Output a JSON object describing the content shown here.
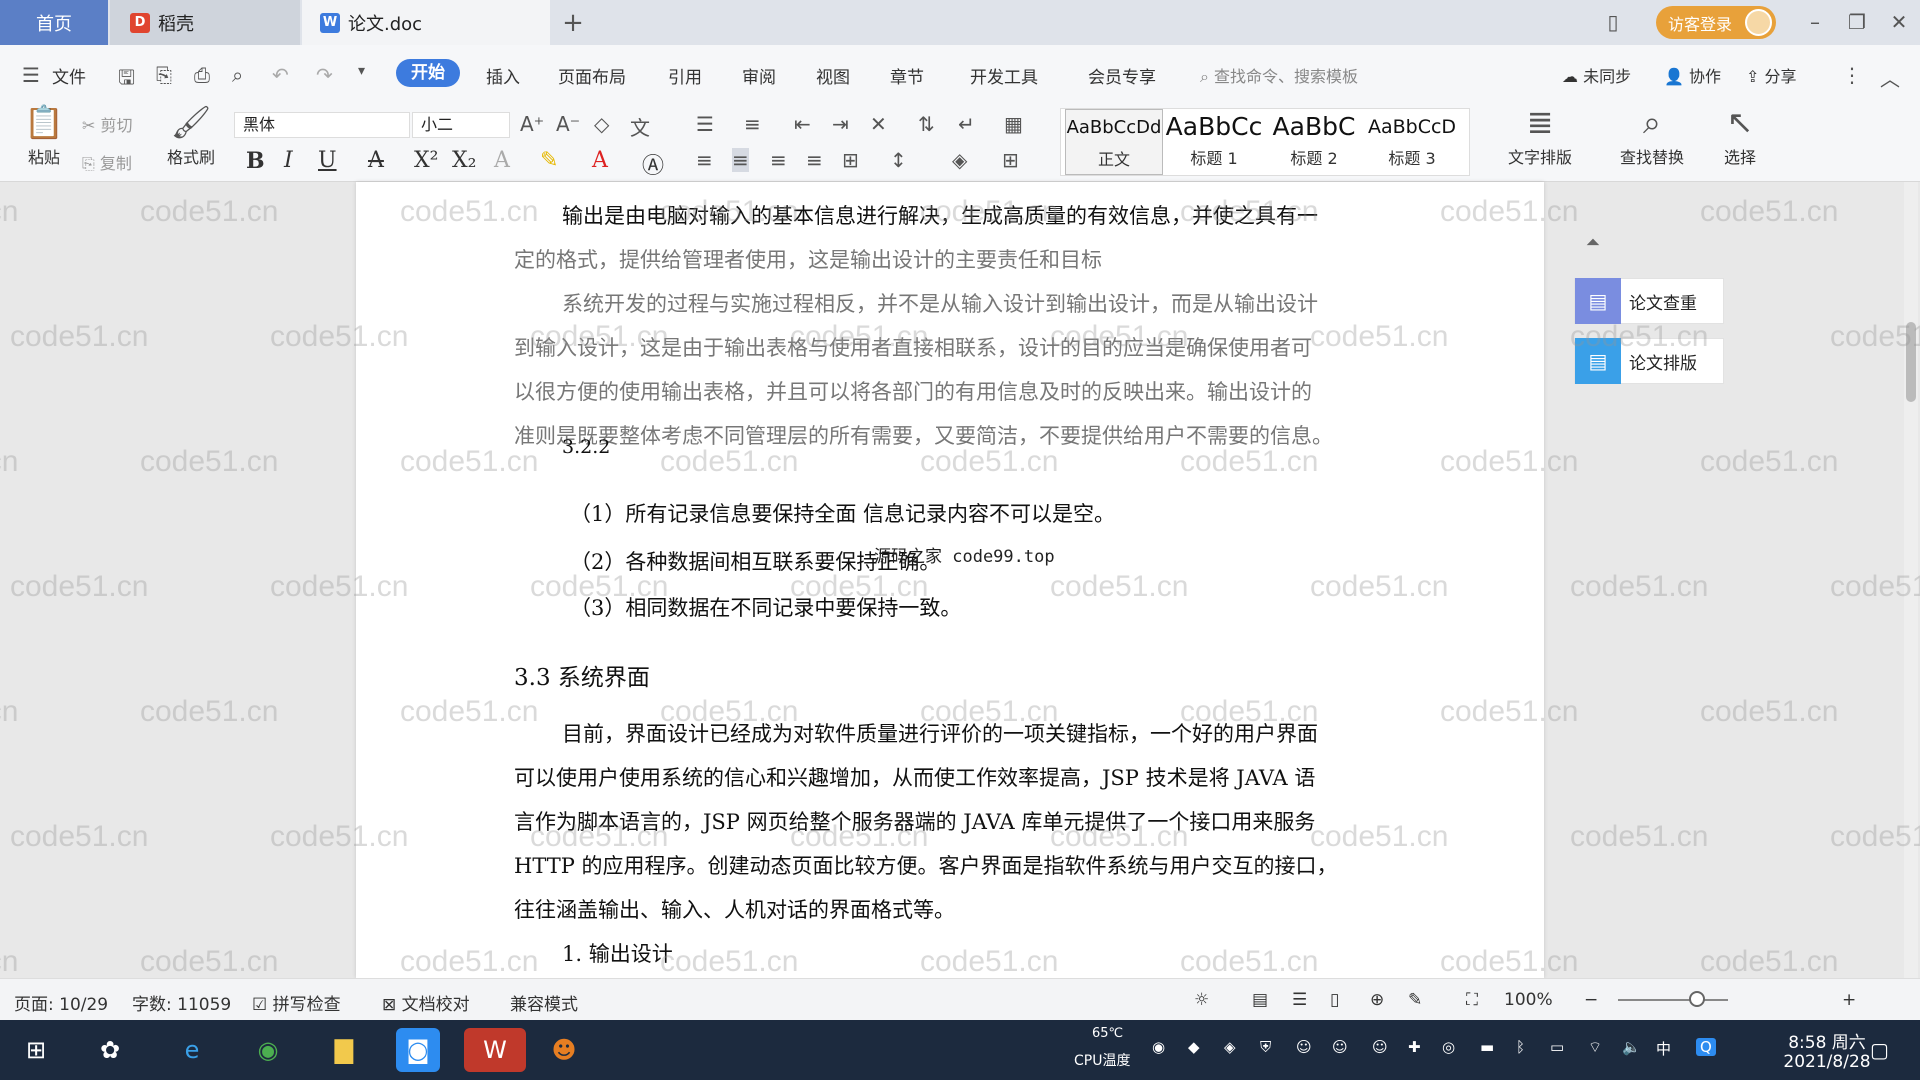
{
  "tabs": {
    "home": "首页",
    "docer": "稻壳",
    "doc": "论文.doc",
    "add": "+"
  },
  "title_bar": {
    "login": "访客登录"
  },
  "menu": {
    "file": "文件",
    "items": [
      "开始",
      "插入",
      "页面布局",
      "引用",
      "审阅",
      "视图",
      "章节",
      "开发工具",
      "会员专享"
    ],
    "search_placeholder": "查找命令、搜索模板",
    "not_synced": "未同步",
    "collab": "协作",
    "share": "分享"
  },
  "ribbon": {
    "paste": "粘贴",
    "cut": "剪切",
    "copy": "复制",
    "format_painter": "格式刷",
    "font_name": "黑体",
    "font_size": "小二",
    "styles": [
      {
        "sample": "AaBbCcDd",
        "name": "正文"
      },
      {
        "sample": "AaBbCc",
        "name": "标题 1"
      },
      {
        "sample": "AaBbC",
        "name": "标题 2"
      },
      {
        "sample": "AaBbCcD",
        "name": "标题 3"
      }
    ],
    "text_layout": "文字排版",
    "find_replace": "查找替换",
    "select": "选择"
  },
  "document": {
    "lines": [
      "输出是由电脑对输入的基本信息进行解决，生成高质量的有效信息，并使之具有一",
      "定的格式，提供给管理者使用，这是输出设计的主要责任和目标",
      "系统开发的过程与实施过程相反，并不是从输入设计到输出设计，而是从输出设计",
      "到输入设计，这是由于输出表格与使用者直接相联系，设计的目的应当是确保使用者可",
      "以很方便的使用输出表格，并且可以将各部门的有用信息及时的反映出来。输出设计的",
      "准则是既要整体考虑不同管理层的所有需要，又要简洁，不要提供给用户不需要的信息。"
    ],
    "subheading": "3.2.2",
    "list_items": [
      "（1）所有记录信息要保持全面   信息记录内容不可以是空。",
      "（2）各种数据间相互联系要保持正确。",
      "（3）相同数据在不同记录中要保持一致。"
    ],
    "stamp": "源码之家 code99.top",
    "heading": "3.3 系统界面",
    "body": [
      "目前，界面设计已经成为对软件质量进行评价的一项关键指标，一个好的用户界面",
      "可以使用户使用系统的信心和兴趣增加，从而使工作效率提高，JSP 技术是将 JAVA 语",
      "言作为脚本语言的，JSP 网页给整个服务器端的 JAVA 库单元提供了一个接口用来服务",
      "HTTP 的应用程序。创建动态页面比较方便。客户界面是指软件系统与用户交互的接口，",
      "往往涵盖输出、输入、人机对话的界面格式等。"
    ],
    "numbered": "1. 输出设计",
    "watermark": "code51.cn"
  },
  "side_panel": {
    "check": "论文查重",
    "layout": "论文排版"
  },
  "status": {
    "page": "页面: 10/29",
    "words": "字数: 11059",
    "spell": "拼写检查",
    "proof": "文档校对",
    "compat": "兼容模式",
    "zoom": "100%",
    "zoom_level": 0.72
  },
  "taskbar": {
    "cpu_temp": "65℃",
    "cpu_label": "CPU温度",
    "ime": "中",
    "time": "8:58 周六",
    "date": "2021/8/28"
  },
  "colors": {
    "accent": "#3d7bde",
    "home_tab": "#5b7fc6",
    "login": "#e8a13a",
    "taskbar": "#1c2a3e"
  }
}
